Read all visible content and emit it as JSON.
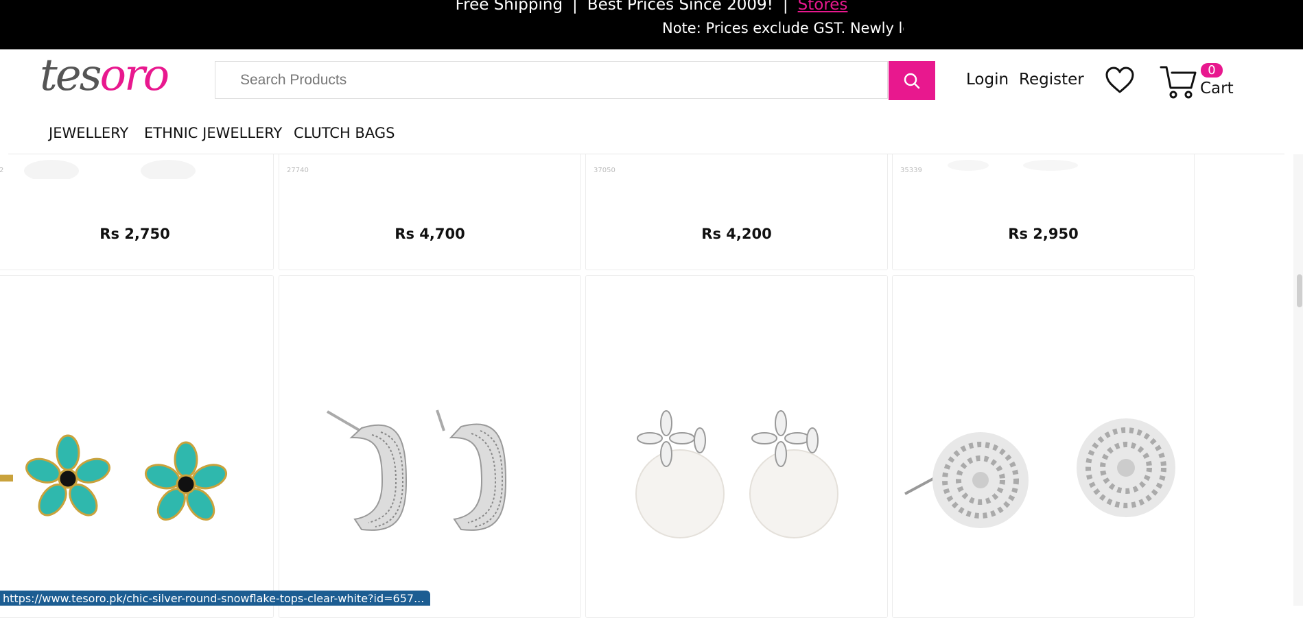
{
  "announcement": {
    "shipping": "Free Shipping",
    "prices": "Best Prices Since 2009!",
    "stores": "Stores",
    "separator": "|",
    "note": "Note: Prices exclude GST. Newly lev"
  },
  "logo": {
    "part1": "tes",
    "part2": "oro"
  },
  "search": {
    "placeholder": "Search Products",
    "value": ""
  },
  "account": {
    "login": "Login",
    "register": "Register"
  },
  "cart": {
    "count": "0",
    "label": "Cart"
  },
  "nav": [
    "JEWELLERY",
    "ETHNIC JEWELLERY",
    "CLUTCH BAGS"
  ],
  "products_top": [
    {
      "sku": "2",
      "price": "Rs 2,750"
    },
    {
      "sku": "27740",
      "price": "Rs 4,700"
    },
    {
      "sku": "37050",
      "price": "Rs 4,200"
    },
    {
      "sku": "35339",
      "price": "Rs 2,950"
    }
  ],
  "products_bottom": [
    {
      "image": "teal-flower-stud-earrings"
    },
    {
      "image": "silver-half-hoop-earrings"
    },
    {
      "image": "pearl-flower-drop-earrings"
    },
    {
      "image": "silver-snowflake-stud-earrings"
    }
  ],
  "status_url": "https://www.tesoro.pk/chic-silver-round-snowflake-tops-clear-white?id=657...",
  "colors": {
    "accent": "#e8188e",
    "topbar": "#000000",
    "status": "#1c5d92"
  }
}
